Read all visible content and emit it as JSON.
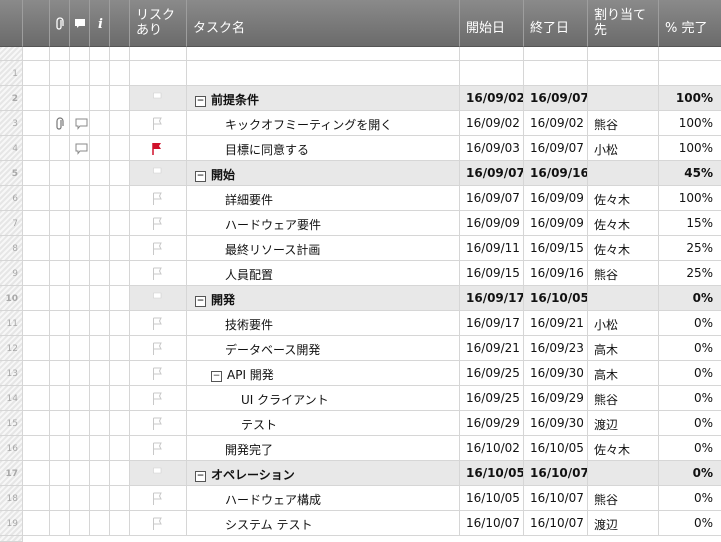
{
  "columns": {
    "attach_icon": "paperclip-icon",
    "comment_icon": "comment-icon",
    "info_label": "i",
    "risk": "リスク\nあり",
    "task": "タスク名",
    "start": "開始日",
    "end": "終了日",
    "assign": "割り当て\n先",
    "pct": "% 完了"
  },
  "rows": [
    {
      "num": "1",
      "task": "",
      "start": "",
      "end": "",
      "assign": "",
      "pct": "",
      "summary": false,
      "indent": 0,
      "toggle": false,
      "flag": "none",
      "attach": false,
      "comment": false
    },
    {
      "num": "2",
      "task": "前提条件",
      "start": "16/09/02",
      "end": "16/09/07",
      "assign": "",
      "pct": "100%",
      "summary": true,
      "indent": 0,
      "toggle": true,
      "flag": "white",
      "attach": false,
      "comment": false
    },
    {
      "num": "3",
      "task": "キックオフミーティングを開く",
      "start": "16/09/02",
      "end": "16/09/02",
      "assign": "熊谷",
      "pct": "100%",
      "summary": false,
      "indent": 1,
      "toggle": false,
      "flag": "outline",
      "attach": true,
      "comment": true
    },
    {
      "num": "4",
      "task": "目標に同意する",
      "start": "16/09/03",
      "end": "16/09/07",
      "assign": "小松",
      "pct": "100%",
      "summary": false,
      "indent": 1,
      "toggle": false,
      "flag": "red",
      "attach": false,
      "comment": true
    },
    {
      "num": "5",
      "task": "開始",
      "start": "16/09/07",
      "end": "16/09/16",
      "assign": "",
      "pct": "45%",
      "summary": true,
      "indent": 0,
      "toggle": true,
      "flag": "white",
      "attach": false,
      "comment": false
    },
    {
      "num": "6",
      "task": "詳細要件",
      "start": "16/09/07",
      "end": "16/09/09",
      "assign": "佐々木",
      "pct": "100%",
      "summary": false,
      "indent": 1,
      "toggle": false,
      "flag": "outline",
      "attach": false,
      "comment": false
    },
    {
      "num": "7",
      "task": "ハードウェア要件",
      "start": "16/09/09",
      "end": "16/09/09",
      "assign": "佐々木",
      "pct": "15%",
      "summary": false,
      "indent": 1,
      "toggle": false,
      "flag": "outline",
      "attach": false,
      "comment": false
    },
    {
      "num": "8",
      "task": "最終リソース計画",
      "start": "16/09/11",
      "end": "16/09/15",
      "assign": "佐々木",
      "pct": "25%",
      "summary": false,
      "indent": 1,
      "toggle": false,
      "flag": "outline",
      "attach": false,
      "comment": false
    },
    {
      "num": "9",
      "task": "人員配置",
      "start": "16/09/15",
      "end": "16/09/16",
      "assign": "熊谷",
      "pct": "25%",
      "summary": false,
      "indent": 1,
      "toggle": false,
      "flag": "outline",
      "attach": false,
      "comment": false
    },
    {
      "num": "10",
      "task": "開発",
      "start": "16/09/17",
      "end": "16/10/05",
      "assign": "",
      "pct": "0%",
      "summary": true,
      "indent": 0,
      "toggle": true,
      "flag": "white",
      "attach": false,
      "comment": false
    },
    {
      "num": "11",
      "task": "技術要件",
      "start": "16/09/17",
      "end": "16/09/21",
      "assign": "小松",
      "pct": "0%",
      "summary": false,
      "indent": 1,
      "toggle": false,
      "flag": "outline",
      "attach": false,
      "comment": false
    },
    {
      "num": "12",
      "task": "データベース開発",
      "start": "16/09/21",
      "end": "16/09/23",
      "assign": "高木",
      "pct": "0%",
      "summary": false,
      "indent": 1,
      "toggle": false,
      "flag": "outline",
      "attach": false,
      "comment": false
    },
    {
      "num": "13",
      "task": "API 開発",
      "start": "16/09/25",
      "end": "16/09/30",
      "assign": "高木",
      "pct": "0%",
      "summary": false,
      "indent": 1,
      "toggle": true,
      "flag": "outline",
      "attach": false,
      "comment": false
    },
    {
      "num": "14",
      "task": "UI クライアント",
      "start": "16/09/25",
      "end": "16/09/29",
      "assign": "熊谷",
      "pct": "0%",
      "summary": false,
      "indent": 2,
      "toggle": false,
      "flag": "outline",
      "attach": false,
      "comment": false
    },
    {
      "num": "15",
      "task": "テスト",
      "start": "16/09/29",
      "end": "16/09/30",
      "assign": "渡辺",
      "pct": "0%",
      "summary": false,
      "indent": 2,
      "toggle": false,
      "flag": "outline",
      "attach": false,
      "comment": false
    },
    {
      "num": "16",
      "task": "開発完了",
      "start": "16/10/02",
      "end": "16/10/05",
      "assign": "佐々木",
      "pct": "0%",
      "summary": false,
      "indent": 1,
      "toggle": false,
      "flag": "outline",
      "attach": false,
      "comment": false
    },
    {
      "num": "17",
      "task": "オペレーション",
      "start": "16/10/05",
      "end": "16/10/07",
      "assign": "",
      "pct": "0%",
      "summary": true,
      "indent": 0,
      "toggle": true,
      "flag": "white",
      "attach": false,
      "comment": false
    },
    {
      "num": "18",
      "task": "ハードウェア構成",
      "start": "16/10/05",
      "end": "16/10/07",
      "assign": "熊谷",
      "pct": "0%",
      "summary": false,
      "indent": 1,
      "toggle": false,
      "flag": "outline",
      "attach": false,
      "comment": false
    },
    {
      "num": "19",
      "task": "システム テスト",
      "start": "16/10/07",
      "end": "16/10/07",
      "assign": "渡辺",
      "pct": "0%",
      "summary": false,
      "indent": 1,
      "toggle": false,
      "flag": "outline",
      "attach": false,
      "comment": false
    }
  ],
  "toggle_glyph": "−",
  "colors": {
    "header": "#7a7a7a",
    "summary_row": "#e8e8e8",
    "risk_flag": "#d0102a"
  }
}
